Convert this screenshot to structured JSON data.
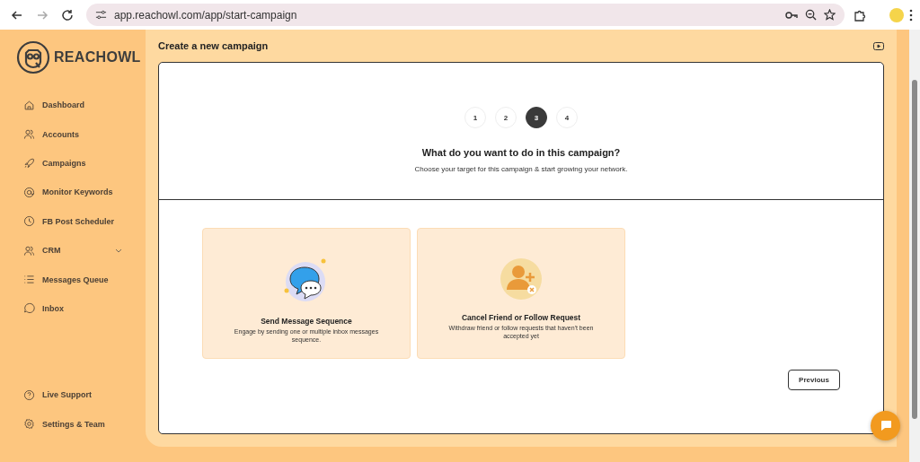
{
  "browser": {
    "url": "app.reachowl.com/app/start-campaign"
  },
  "sidebar": {
    "logo": "REACHOWL",
    "items": [
      {
        "label": "Dashboard",
        "kind": "home",
        "submenu": false
      },
      {
        "label": "Accounts",
        "kind": "users",
        "submenu": false
      },
      {
        "label": "Campaigns",
        "kind": "rocket",
        "submenu": false
      },
      {
        "label": "Monitor Keywords",
        "kind": "at",
        "submenu": false
      },
      {
        "label": "FB Post Scheduler",
        "kind": "clock",
        "submenu": false
      },
      {
        "label": "CRM",
        "kind": "users",
        "submenu": true
      },
      {
        "label": "Messages Queue",
        "kind": "list",
        "submenu": false
      },
      {
        "label": "Inbox",
        "kind": "chat",
        "submenu": false
      }
    ],
    "bottom_items": [
      {
        "label": "Live Support",
        "kind": "help"
      },
      {
        "label": "Settings & Team",
        "kind": "gear"
      }
    ]
  },
  "page": {
    "title": "Create a new campaign",
    "steps": [
      {
        "label": "1",
        "selected": false
      },
      {
        "label": "2",
        "selected": false
      },
      {
        "label": "3",
        "selected": true
      },
      {
        "label": "4",
        "selected": false
      }
    ],
    "question": "What do you want to do in this campaign?",
    "subtitle": "Choose your target for this campaign & start growing your network.",
    "options": [
      {
        "kind": "message",
        "title": "Send Message Sequence",
        "description": "Engage by sending one or multiple inbox messages sequence."
      },
      {
        "kind": "cancel",
        "title": "Cancel Friend or Follow Request",
        "description": "Withdraw friend or follow requests that haven't been accepted yet"
      }
    ],
    "buttons": [
      "Previous"
    ]
  }
}
